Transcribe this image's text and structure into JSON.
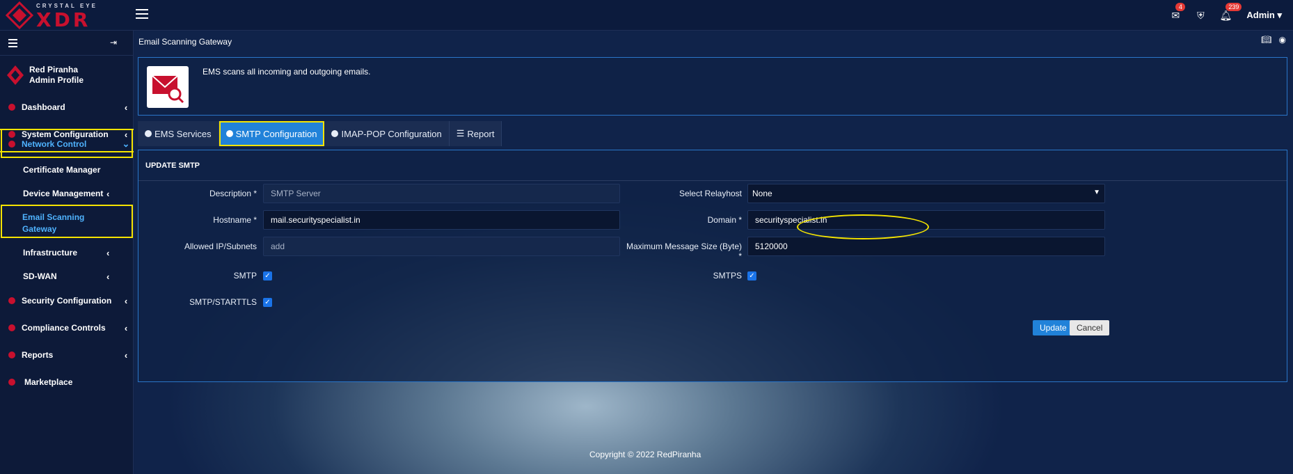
{
  "brand": {
    "tagline": "CRYSTAL EYE",
    "name": "XDR"
  },
  "topbar": {
    "mail_badge": "4",
    "notifications_badge": "239",
    "user_label": "Admin"
  },
  "sidebar": {
    "profile_name": "Red Piranha",
    "profile_role": "Admin Profile",
    "items": [
      {
        "label": "Dashboard"
      },
      {
        "label": "System Configuration"
      },
      {
        "label": "Network Control"
      },
      {
        "label": "Certificate Manager"
      },
      {
        "label": "Device Management"
      },
      {
        "label": "Email Scanning"
      },
      {
        "label": "Gateway"
      },
      {
        "label": "Infrastructure"
      },
      {
        "label": "SD-WAN"
      },
      {
        "label": "Security Configuration"
      },
      {
        "label": "Compliance Controls"
      },
      {
        "label": "Reports"
      },
      {
        "label": "Marketplace"
      }
    ]
  },
  "page": {
    "breadcrumb": "Email Scanning Gateway",
    "info_text": "EMS scans all incoming and outgoing emails.",
    "tabs": [
      {
        "label": "EMS Services"
      },
      {
        "label": "SMTP Configuration"
      },
      {
        "label": "IMAP-POP Configuration"
      },
      {
        "label": "Report"
      }
    ]
  },
  "form": {
    "title": "UPDATE SMTP",
    "description_label": "Description *",
    "description_placeholder": "SMTP Server",
    "hostname_label": "Hostname *",
    "hostname_value": "mail.securityspecialist.in",
    "allowed_label": "Allowed IP/Subnets",
    "allowed_placeholder": "add",
    "smtp_label": "SMTP",
    "starttls_label": "SMTP/STARTTLS",
    "relayhost_label": "Select Relayhost",
    "relayhost_value": "None",
    "domain_label": "Domain *",
    "domain_value": "securityspecialist.in",
    "maxsize_label": "Maximum Message Size (Byte) *",
    "maxsize_value": "5120000",
    "smtps_label": "SMTPS",
    "smtp_checked": true,
    "starttls_checked": true,
    "smtps_checked": true,
    "update_label": "Update",
    "cancel_label": "Cancel"
  },
  "footer": {
    "copyright": "Copyright © 2022 RedPiranha"
  },
  "colors": {
    "accent": "#2182d9",
    "brand_red": "#c8102e",
    "highlight": "#f5e400"
  }
}
